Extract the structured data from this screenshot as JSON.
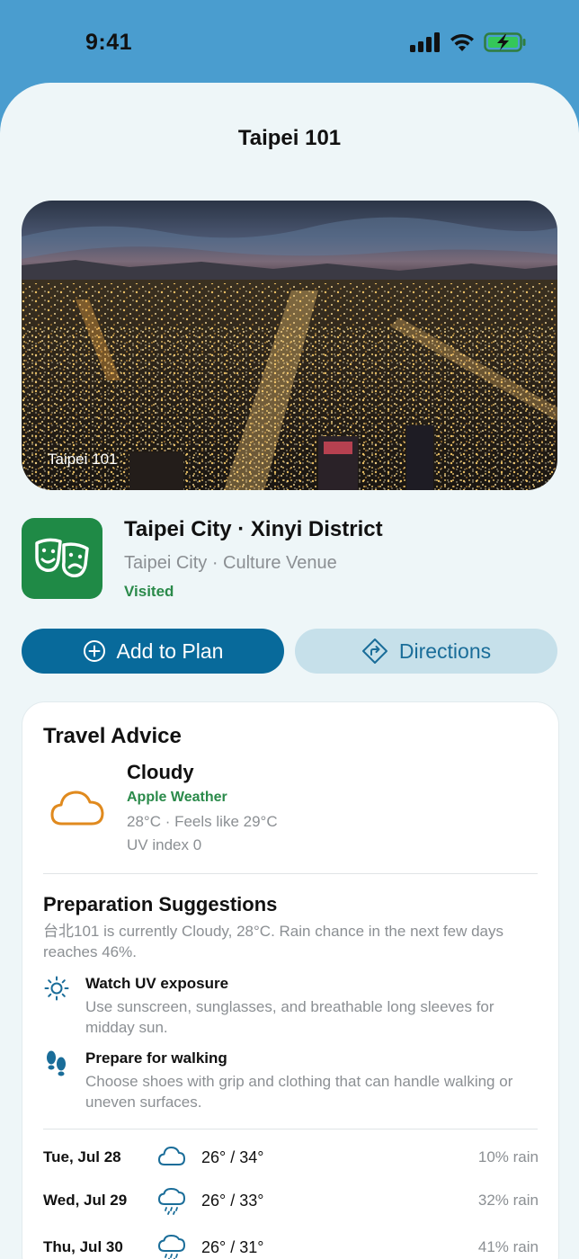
{
  "status_bar": {
    "time": "9:41",
    "icons": [
      "cellular-signal-icon",
      "wifi-icon",
      "battery-charging-icon"
    ]
  },
  "nav": {
    "title": "Taipei 101"
  },
  "hero": {
    "caption": "Taipei 101"
  },
  "place": {
    "icon": "theater-masks-icon",
    "name": "Taipei City · Xinyi District",
    "subtitle": "Taipei City · Culture Venue",
    "status": "Visited"
  },
  "actions": {
    "add_label": "Add to Plan",
    "add_icon": "plus-circle-icon",
    "directions_label": "Directions",
    "directions_icon": "directions-diamond-icon"
  },
  "advice": {
    "title": "Travel Advice",
    "weather": {
      "icon": "cloud-icon",
      "condition": "Cloudy",
      "source": "Apple Weather",
      "temp_line": "28°C · Feels like 29°C",
      "uv_line": "UV index 0"
    },
    "prep": {
      "title": "Preparation Suggestions",
      "summary": "台北101 is currently Cloudy, 28°C. Rain chance in the next few days reaches 46%.",
      "tips": [
        {
          "icon": "sun-icon",
          "title": "Watch UV exposure",
          "desc": "Use sunscreen, sunglasses, and breathable long sleeves for midday sun."
        },
        {
          "icon": "footprints-icon",
          "title": "Prepare for walking",
          "desc": "Choose shoes with grip and clothing that can handle walking or uneven surfaces."
        }
      ]
    },
    "forecast": [
      {
        "day": "Tue, Jul 28",
        "icon": "cloud-icon",
        "temps": "26° / 34°",
        "rain": "10% rain"
      },
      {
        "day": "Wed, Jul 29",
        "icon": "cloud-drizzle-icon",
        "temps": "26° / 33°",
        "rain": "32% rain"
      },
      {
        "day": "Thu, Jul 30",
        "icon": "cloud-drizzle-icon",
        "temps": "26° / 31°",
        "rain": "41% rain"
      }
    ]
  },
  "colors": {
    "header_bg": "#4a9dcf",
    "sheet_bg": "#eef6f8",
    "primary": "#086a9b",
    "secondary_bg": "#c6e0ea",
    "green": "#2a8a4a",
    "weather_orange": "#e08a1e"
  }
}
